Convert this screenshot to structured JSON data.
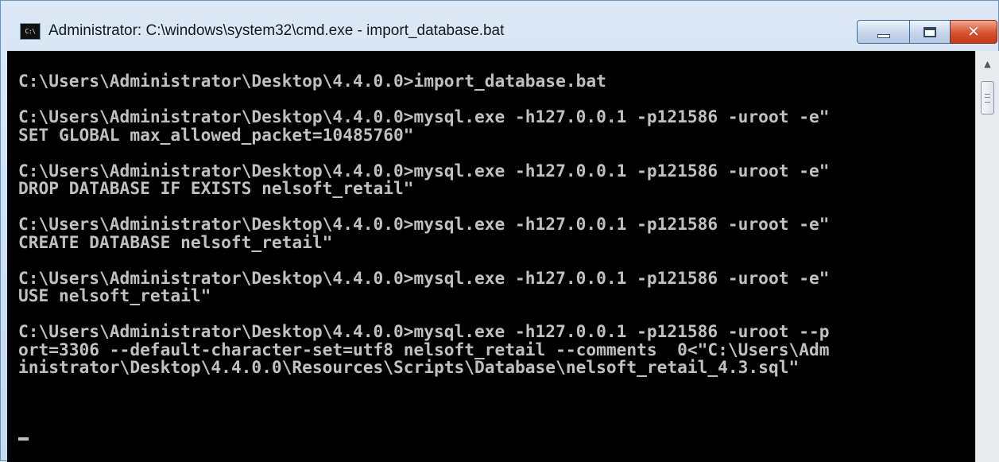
{
  "window": {
    "title": "Administrator: C:\\windows\\system32\\cmd.exe - import_database.bat",
    "icon_label": "C:\\",
    "controls": {
      "minimize": "minimize-icon",
      "maximize": "maximize-icon",
      "close": "close-icon",
      "close_glyph": "✕"
    }
  },
  "console": {
    "lines": [
      "C:\\Users\\Administrator\\Desktop\\4.4.0.0>import_database.bat",
      "",
      "C:\\Users\\Administrator\\Desktop\\4.4.0.0>mysql.exe -h127.0.0.1 -p121586 -uroot -e\"",
      "SET GLOBAL max_allowed_packet=10485760\"",
      "",
      "C:\\Users\\Administrator\\Desktop\\4.4.0.0>mysql.exe -h127.0.0.1 -p121586 -uroot -e\"",
      "DROP DATABASE IF EXISTS nelsoft_retail\"",
      "",
      "C:\\Users\\Administrator\\Desktop\\4.4.0.0>mysql.exe -h127.0.0.1 -p121586 -uroot -e\"",
      "CREATE DATABASE nelsoft_retail\"",
      "",
      "C:\\Users\\Administrator\\Desktop\\4.4.0.0>mysql.exe -h127.0.0.1 -p121586 -uroot -e\"",
      "USE nelsoft_retail\"",
      "",
      "C:\\Users\\Administrator\\Desktop\\4.4.0.0>mysql.exe -h127.0.0.1 -p121586 -uroot --p",
      "ort=3306 --default-character-set=utf8 nelsoft_retail --comments  0<\"C:\\Users\\Adm",
      "inistrator\\Desktop\\4.4.0.0\\Resources\\Scripts\\Database\\nelsoft_retail_4.3.sql\""
    ],
    "colors": {
      "background": "#000000",
      "foreground": "#c0c0c0"
    }
  },
  "scrollbar": {
    "up_arrow": "▲"
  }
}
